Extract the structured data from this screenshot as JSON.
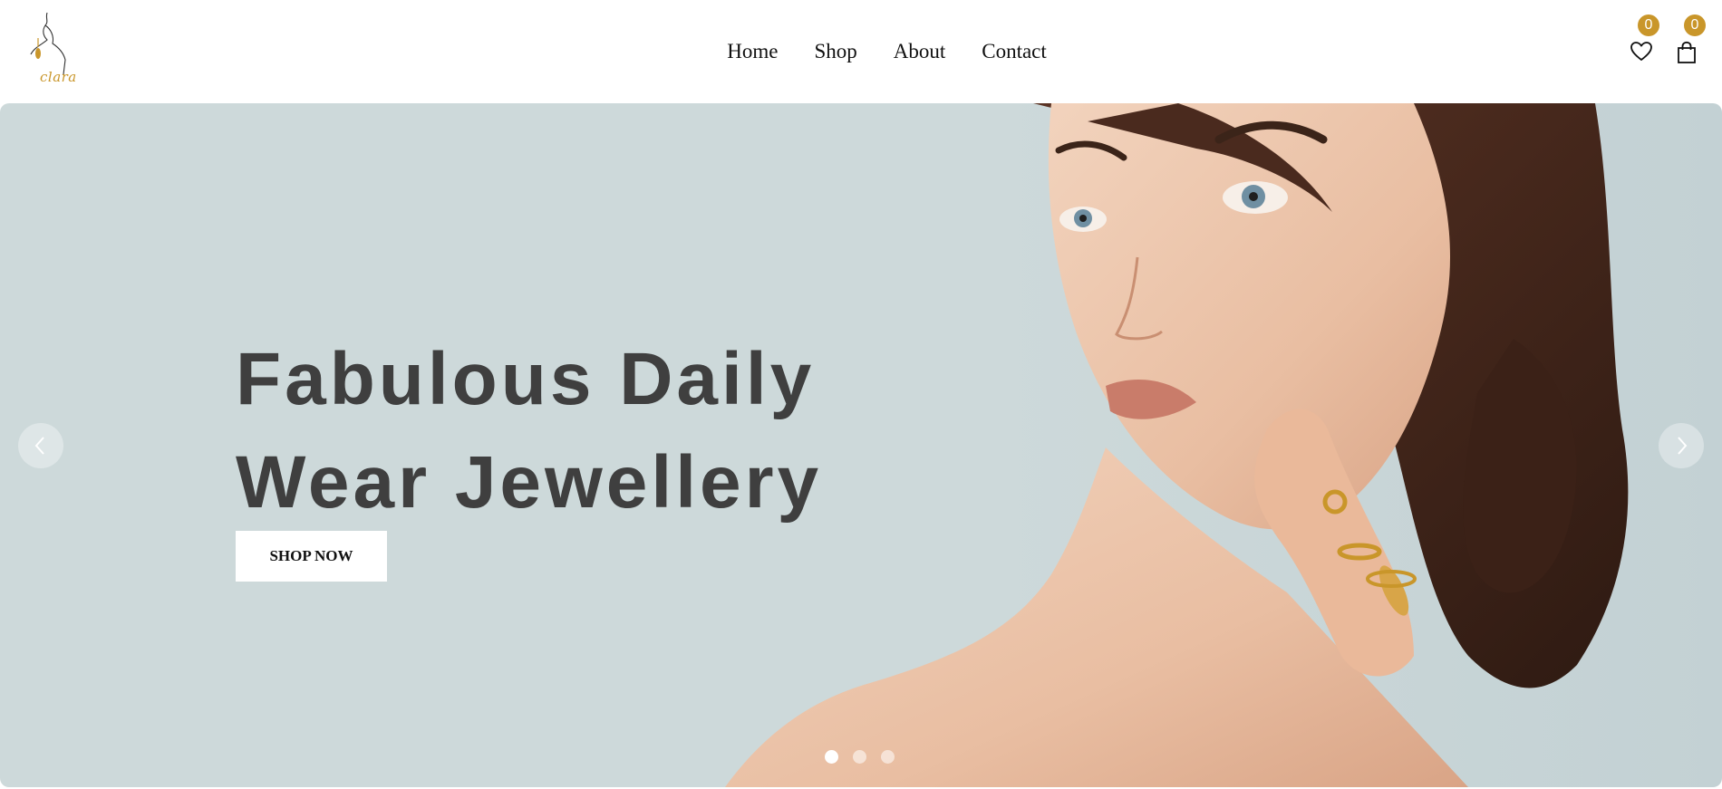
{
  "nav": {
    "items": [
      "Home",
      "Shop",
      "About",
      "Contact"
    ]
  },
  "icons": {
    "wishlist": "heart-icon",
    "cart": "shopping-bag-icon"
  },
  "counts": {
    "wishlist": "0",
    "cart": "0"
  },
  "logo": {
    "text": "clara"
  },
  "hero": {
    "headline_line1": "Fabulous Daily",
    "headline_line2": "Wear Jewellery",
    "cta_label": "SHOP NOW",
    "slides": 3,
    "active_slide": 1
  },
  "colors": {
    "accent": "#c9962a",
    "hero_bg": "#cdd9da",
    "headline": "#3f3f3f"
  }
}
